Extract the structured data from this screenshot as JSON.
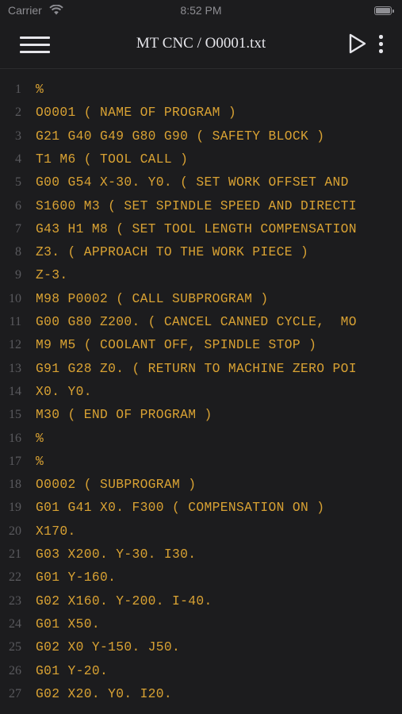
{
  "status_bar": {
    "carrier": "Carrier",
    "time": "8:52 PM"
  },
  "nav": {
    "title": "MT CNC / O0001.txt"
  },
  "icons": {
    "menu": "hamburger-menu-icon",
    "play": "play-icon",
    "more": "more-vertical-icon"
  },
  "colors": {
    "background": "#1c1c1e",
    "code_text": "#d9a233",
    "line_number": "#5a5a5e",
    "nav_text": "#e5e5ea"
  },
  "lines": [
    {
      "num": "1",
      "code": "%"
    },
    {
      "num": "2",
      "code": "O0001 ( NAME OF PROGRAM )"
    },
    {
      "num": "3",
      "code": "G21 G40 G49 G80 G90 ( SAFETY BLOCK )"
    },
    {
      "num": "4",
      "code": "T1 M6 ( TOOL CALL )"
    },
    {
      "num": "5",
      "code": "G00 G54 X-30. Y0. ( SET WORK OFFSET AND"
    },
    {
      "num": "6",
      "code": "S1600 M3 ( SET SPINDLE SPEED AND DIRECTI"
    },
    {
      "num": "7",
      "code": "G43 H1 M8 ( SET TOOL LENGTH COMPENSATION"
    },
    {
      "num": "8",
      "code": "Z3. ( APPROACH TO THE WORK PIECE )"
    },
    {
      "num": "9",
      "code": "Z-3."
    },
    {
      "num": "10",
      "code": "M98 P0002 ( CALL SUBPROGRAM )"
    },
    {
      "num": "11",
      "code": "G00 G80 Z200. ( CANCEL CANNED CYCLE,  MO"
    },
    {
      "num": "12",
      "code": "M9 M5 ( COOLANT OFF, SPINDLE STOP )"
    },
    {
      "num": "13",
      "code": "G91 G28 Z0. ( RETURN TO MACHINE ZERO POI"
    },
    {
      "num": "14",
      "code": "X0. Y0."
    },
    {
      "num": "15",
      "code": "M30 ( END OF PROGRAM )"
    },
    {
      "num": "16",
      "code": "%"
    },
    {
      "num": "17",
      "code": "%"
    },
    {
      "num": "18",
      "code": "O0002 ( SUBPROGRAM )"
    },
    {
      "num": "19",
      "code": "G01 G41 X0. F300 ( COMPENSATION ON )"
    },
    {
      "num": "20",
      "code": "X170."
    },
    {
      "num": "21",
      "code": "G03 X200. Y-30. I30."
    },
    {
      "num": "22",
      "code": "G01 Y-160."
    },
    {
      "num": "23",
      "code": "G02 X160. Y-200. I-40."
    },
    {
      "num": "24",
      "code": "G01 X50."
    },
    {
      "num": "25",
      "code": "G02 X0 Y-150. J50."
    },
    {
      "num": "26",
      "code": "G01 Y-20."
    },
    {
      "num": "27",
      "code": "G02 X20. Y0. I20."
    }
  ]
}
